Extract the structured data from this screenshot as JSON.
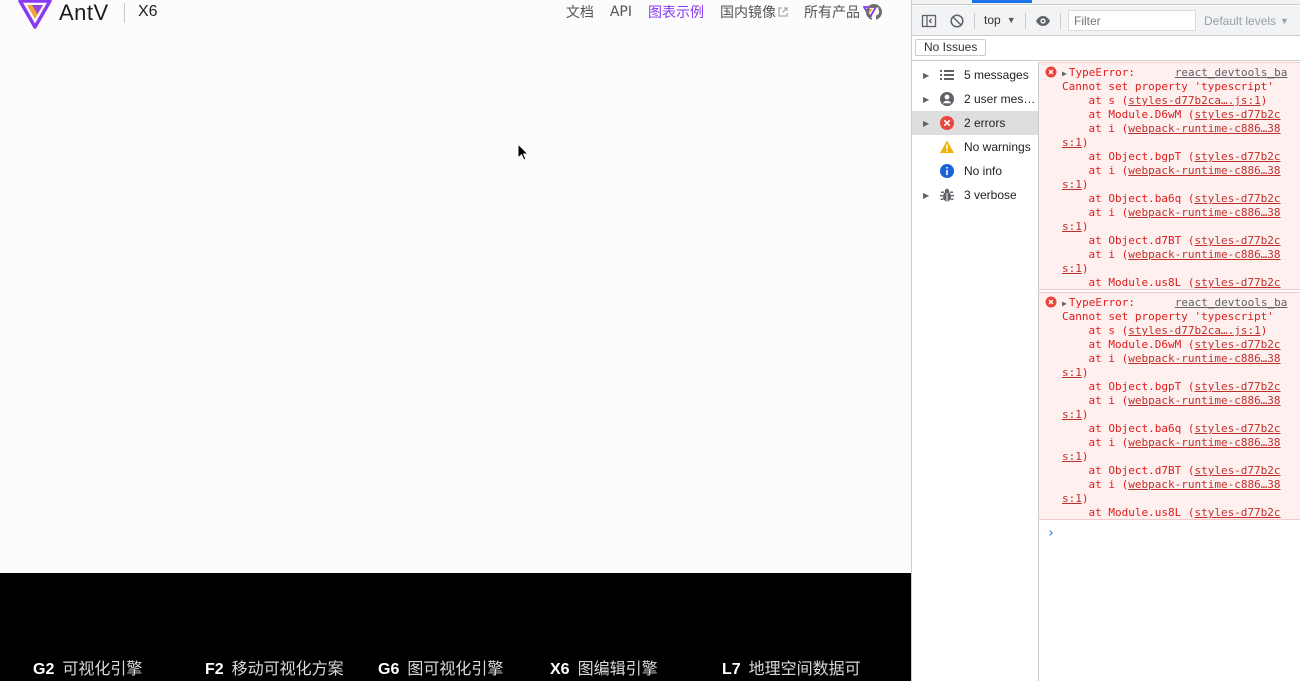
{
  "site": {
    "brand": "AntV",
    "product": "X6",
    "nav": [
      {
        "label": "文档",
        "active": false
      },
      {
        "label": "API",
        "active": false
      },
      {
        "label": "图表示例",
        "active": true
      },
      {
        "label": "国内镜像",
        "active": false,
        "external": true
      },
      {
        "label": "所有产品",
        "active": false,
        "dropdown": true
      }
    ],
    "accent_color": "#873bf4",
    "footer": [
      {
        "code": "G2",
        "label": "可视化引擎"
      },
      {
        "code": "F2",
        "label": "移动可视化方案"
      },
      {
        "code": "G6",
        "label": "图可视化引擎"
      },
      {
        "code": "X6",
        "label": "图编辑引擎"
      },
      {
        "code": "L7",
        "label": "地理空间数据可"
      }
    ]
  },
  "devtools": {
    "context": "top",
    "filter_placeholder": "Filter",
    "levels": "Default levels",
    "issues": "No Issues",
    "sidebar": [
      {
        "label": "5 messages",
        "icon": "list-icon",
        "expandable": true,
        "selected": false
      },
      {
        "label": "2 user mes…",
        "icon": "user-icon",
        "expandable": true,
        "selected": false
      },
      {
        "label": "2 errors",
        "icon": "error-icon",
        "expandable": true,
        "selected": true
      },
      {
        "label": "No warnings",
        "icon": "warning-icon",
        "expandable": false,
        "selected": false
      },
      {
        "label": "No info",
        "icon": "info-icon",
        "expandable": false,
        "selected": false
      },
      {
        "label": "3 verbose",
        "icon": "bug-icon",
        "expandable": true,
        "selected": false
      }
    ],
    "errors": [
      {
        "title": "TypeError:",
        "source": "react_devtools_ba",
        "message": "Cannot set property 'typescript'",
        "stack": [
          {
            "prefix": "    at s (",
            "link": "styles-d77b2ca….js:1",
            "suffix": ")"
          },
          {
            "prefix": "    at Module.D6wM (",
            "link": "styles-d77b2c",
            "suffix": ""
          },
          {
            "prefix": "    at i (",
            "link": "webpack-runtime-c886…38",
            "suffix": ""
          },
          {
            "prefix": "",
            "link": "s:1",
            "suffix": ")"
          },
          {
            "prefix": "    at Object.bgpT (",
            "link": "styles-d77b2c",
            "suffix": ""
          },
          {
            "prefix": "    at i (",
            "link": "webpack-runtime-c886…38",
            "suffix": ""
          },
          {
            "prefix": "",
            "link": "s:1",
            "suffix": ")"
          },
          {
            "prefix": "    at Object.ba6q (",
            "link": "styles-d77b2c",
            "suffix": ""
          },
          {
            "prefix": "    at i (",
            "link": "webpack-runtime-c886…38",
            "suffix": ""
          },
          {
            "prefix": "",
            "link": "s:1",
            "suffix": ")"
          },
          {
            "prefix": "    at Object.d7BT (",
            "link": "styles-d77b2c",
            "suffix": ""
          },
          {
            "prefix": "    at i (",
            "link": "webpack-runtime-c886…38",
            "suffix": ""
          },
          {
            "prefix": "",
            "link": "s:1",
            "suffix": ")"
          },
          {
            "prefix": "    at Module.us8L (",
            "link": "styles-d77b2c",
            "suffix": ""
          }
        ]
      },
      {
        "title": "TypeError:",
        "source": "react_devtools_ba",
        "message": "Cannot set property 'typescript'",
        "stack": [
          {
            "prefix": "    at s (",
            "link": "styles-d77b2ca….js:1",
            "suffix": ")"
          },
          {
            "prefix": "    at Module.D6wM (",
            "link": "styles-d77b2c",
            "suffix": ""
          },
          {
            "prefix": "    at i (",
            "link": "webpack-runtime-c886…38",
            "suffix": ""
          },
          {
            "prefix": "",
            "link": "s:1",
            "suffix": ")"
          },
          {
            "prefix": "    at Object.bgpT (",
            "link": "styles-d77b2c",
            "suffix": ""
          },
          {
            "prefix": "    at i (",
            "link": "webpack-runtime-c886…38",
            "suffix": ""
          },
          {
            "prefix": "",
            "link": "s:1",
            "suffix": ")"
          },
          {
            "prefix": "    at Object.ba6q (",
            "link": "styles-d77b2c",
            "suffix": ""
          },
          {
            "prefix": "    at i (",
            "link": "webpack-runtime-c886…38",
            "suffix": ""
          },
          {
            "prefix": "",
            "link": "s:1",
            "suffix": ")"
          },
          {
            "prefix": "    at Object.d7BT (",
            "link": "styles-d77b2c",
            "suffix": ""
          },
          {
            "prefix": "    at i (",
            "link": "webpack-runtime-c886…38",
            "suffix": ""
          },
          {
            "prefix": "",
            "link": "s:1",
            "suffix": ")"
          },
          {
            "prefix": "    at Module.us8L (",
            "link": "styles-d77b2c",
            "suffix": ""
          }
        ]
      }
    ],
    "prompt_symbol": "›"
  }
}
